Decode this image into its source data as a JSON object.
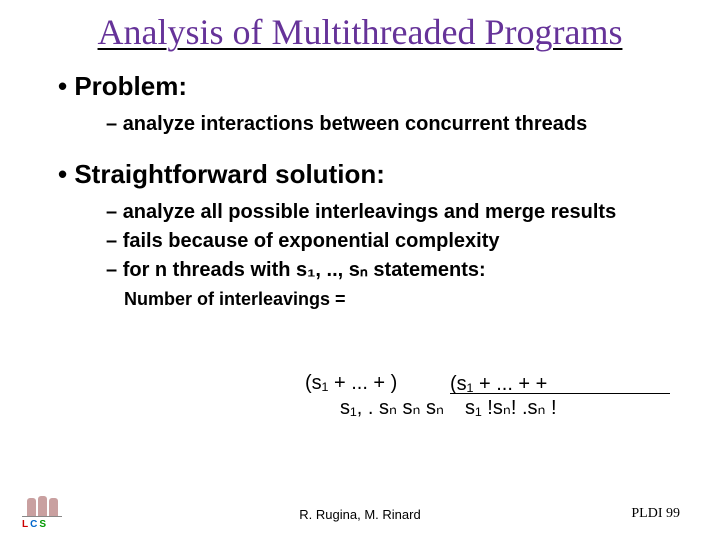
{
  "title": "Analysis of Multithreaded Programs",
  "problem": {
    "heading": "Problem:",
    "items": [
      "analyze interactions between concurrent threads"
    ]
  },
  "solution": {
    "heading": "Straightforward solution:",
    "items": [
      "analyze all possible interleavings and merge results",
      "fails because of exponential complexity",
      "for n threads with s₁, .., sₙ statements:"
    ]
  },
  "interleavings_label": "Number of interleavings  =",
  "formula": {
    "overlay1": "(s₁ + ... + )",
    "overlay2": "(s₁ + ... +  +",
    "overlay3": "s₁, .  sₙ sₙ sₙ",
    "overlay4": "s₁ !sₙ! .sₙ !"
  },
  "footer": {
    "authors": "R. Rugina, M. Rinard",
    "conference": "PLDI 99",
    "logo_letters": {
      "l": "L",
      "c": "C",
      "s": "S"
    }
  }
}
